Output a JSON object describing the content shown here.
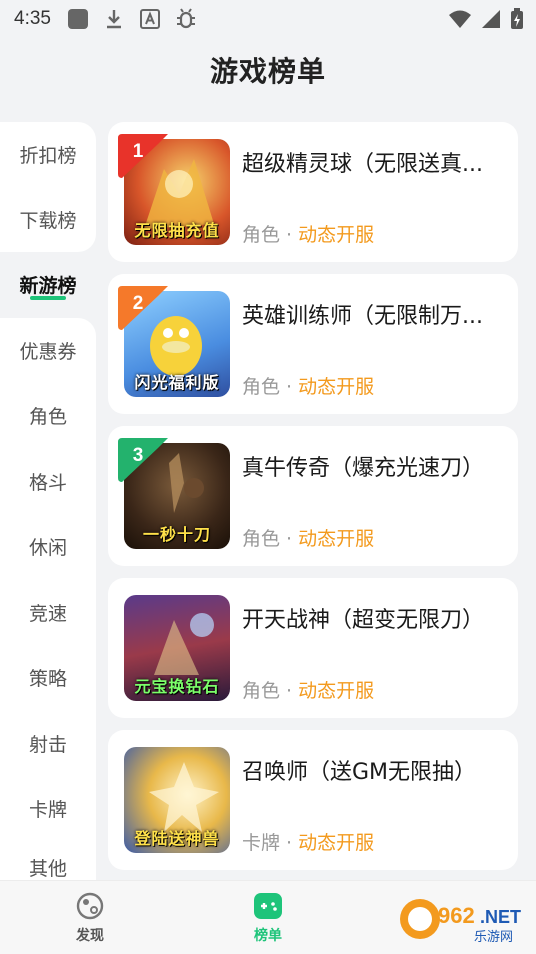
{
  "status_bar": {
    "time": "4:35",
    "icons": [
      "app-icon",
      "download-icon",
      "font-icon",
      "bug-icon"
    ],
    "right_icons": [
      "wifi-icon",
      "signal-icon",
      "battery-icon"
    ]
  },
  "header": {
    "title": "游戏榜单"
  },
  "sidebar": {
    "items": [
      {
        "label": "折扣榜"
      },
      {
        "label": "下载榜"
      },
      {
        "label": "新游榜"
      },
      {
        "label": "优惠券"
      },
      {
        "label": "角色"
      },
      {
        "label": "格斗"
      },
      {
        "label": "休闲"
      },
      {
        "label": "竞速"
      },
      {
        "label": "策略"
      },
      {
        "label": "射击"
      },
      {
        "label": "卡牌"
      },
      {
        "label": "其他"
      }
    ],
    "active": "新游榜",
    "accent": "#1ec47a"
  },
  "games": [
    {
      "rank": "1",
      "title": "超级精灵球（无限送真...",
      "category": "角色",
      "tag": "动态开服",
      "thumb_caption": "无限抽充值",
      "rank_color": "#e8332a"
    },
    {
      "rank": "2",
      "title": "英雄训练师（无限制万...",
      "category": "角色",
      "tag": "动态开服",
      "thumb_caption": "闪光福利版",
      "rank_color": "#f5792a"
    },
    {
      "rank": "3",
      "title": "真牛传奇（爆充光速刀）",
      "category": "角色",
      "tag": "动态开服",
      "thumb_caption": "一秒十刀",
      "rank_color": "#23b26d"
    },
    {
      "rank": "",
      "title": "开天战神（超变无限刀）",
      "category": "角色",
      "tag": "动态开服",
      "thumb_caption": "元宝换钻石",
      "rank_color": ""
    },
    {
      "rank": "",
      "title": "召唤师（送GM无限抽）",
      "category": "卡牌",
      "tag": "动态开服",
      "thumb_caption": "登陆送神兽",
      "rank_color": ""
    }
  ],
  "meta_separator": "·",
  "bottom_nav": {
    "items": [
      {
        "label": "发现",
        "icon": "discover-icon"
      },
      {
        "label": "榜单",
        "icon": "gamepad-icon"
      }
    ],
    "active": "榜单"
  },
  "watermark": {
    "brand": "962.NET",
    "sub": "乐游网"
  },
  "colors": {
    "tag": "#f39a1e",
    "active_green": "#1ec47a"
  }
}
